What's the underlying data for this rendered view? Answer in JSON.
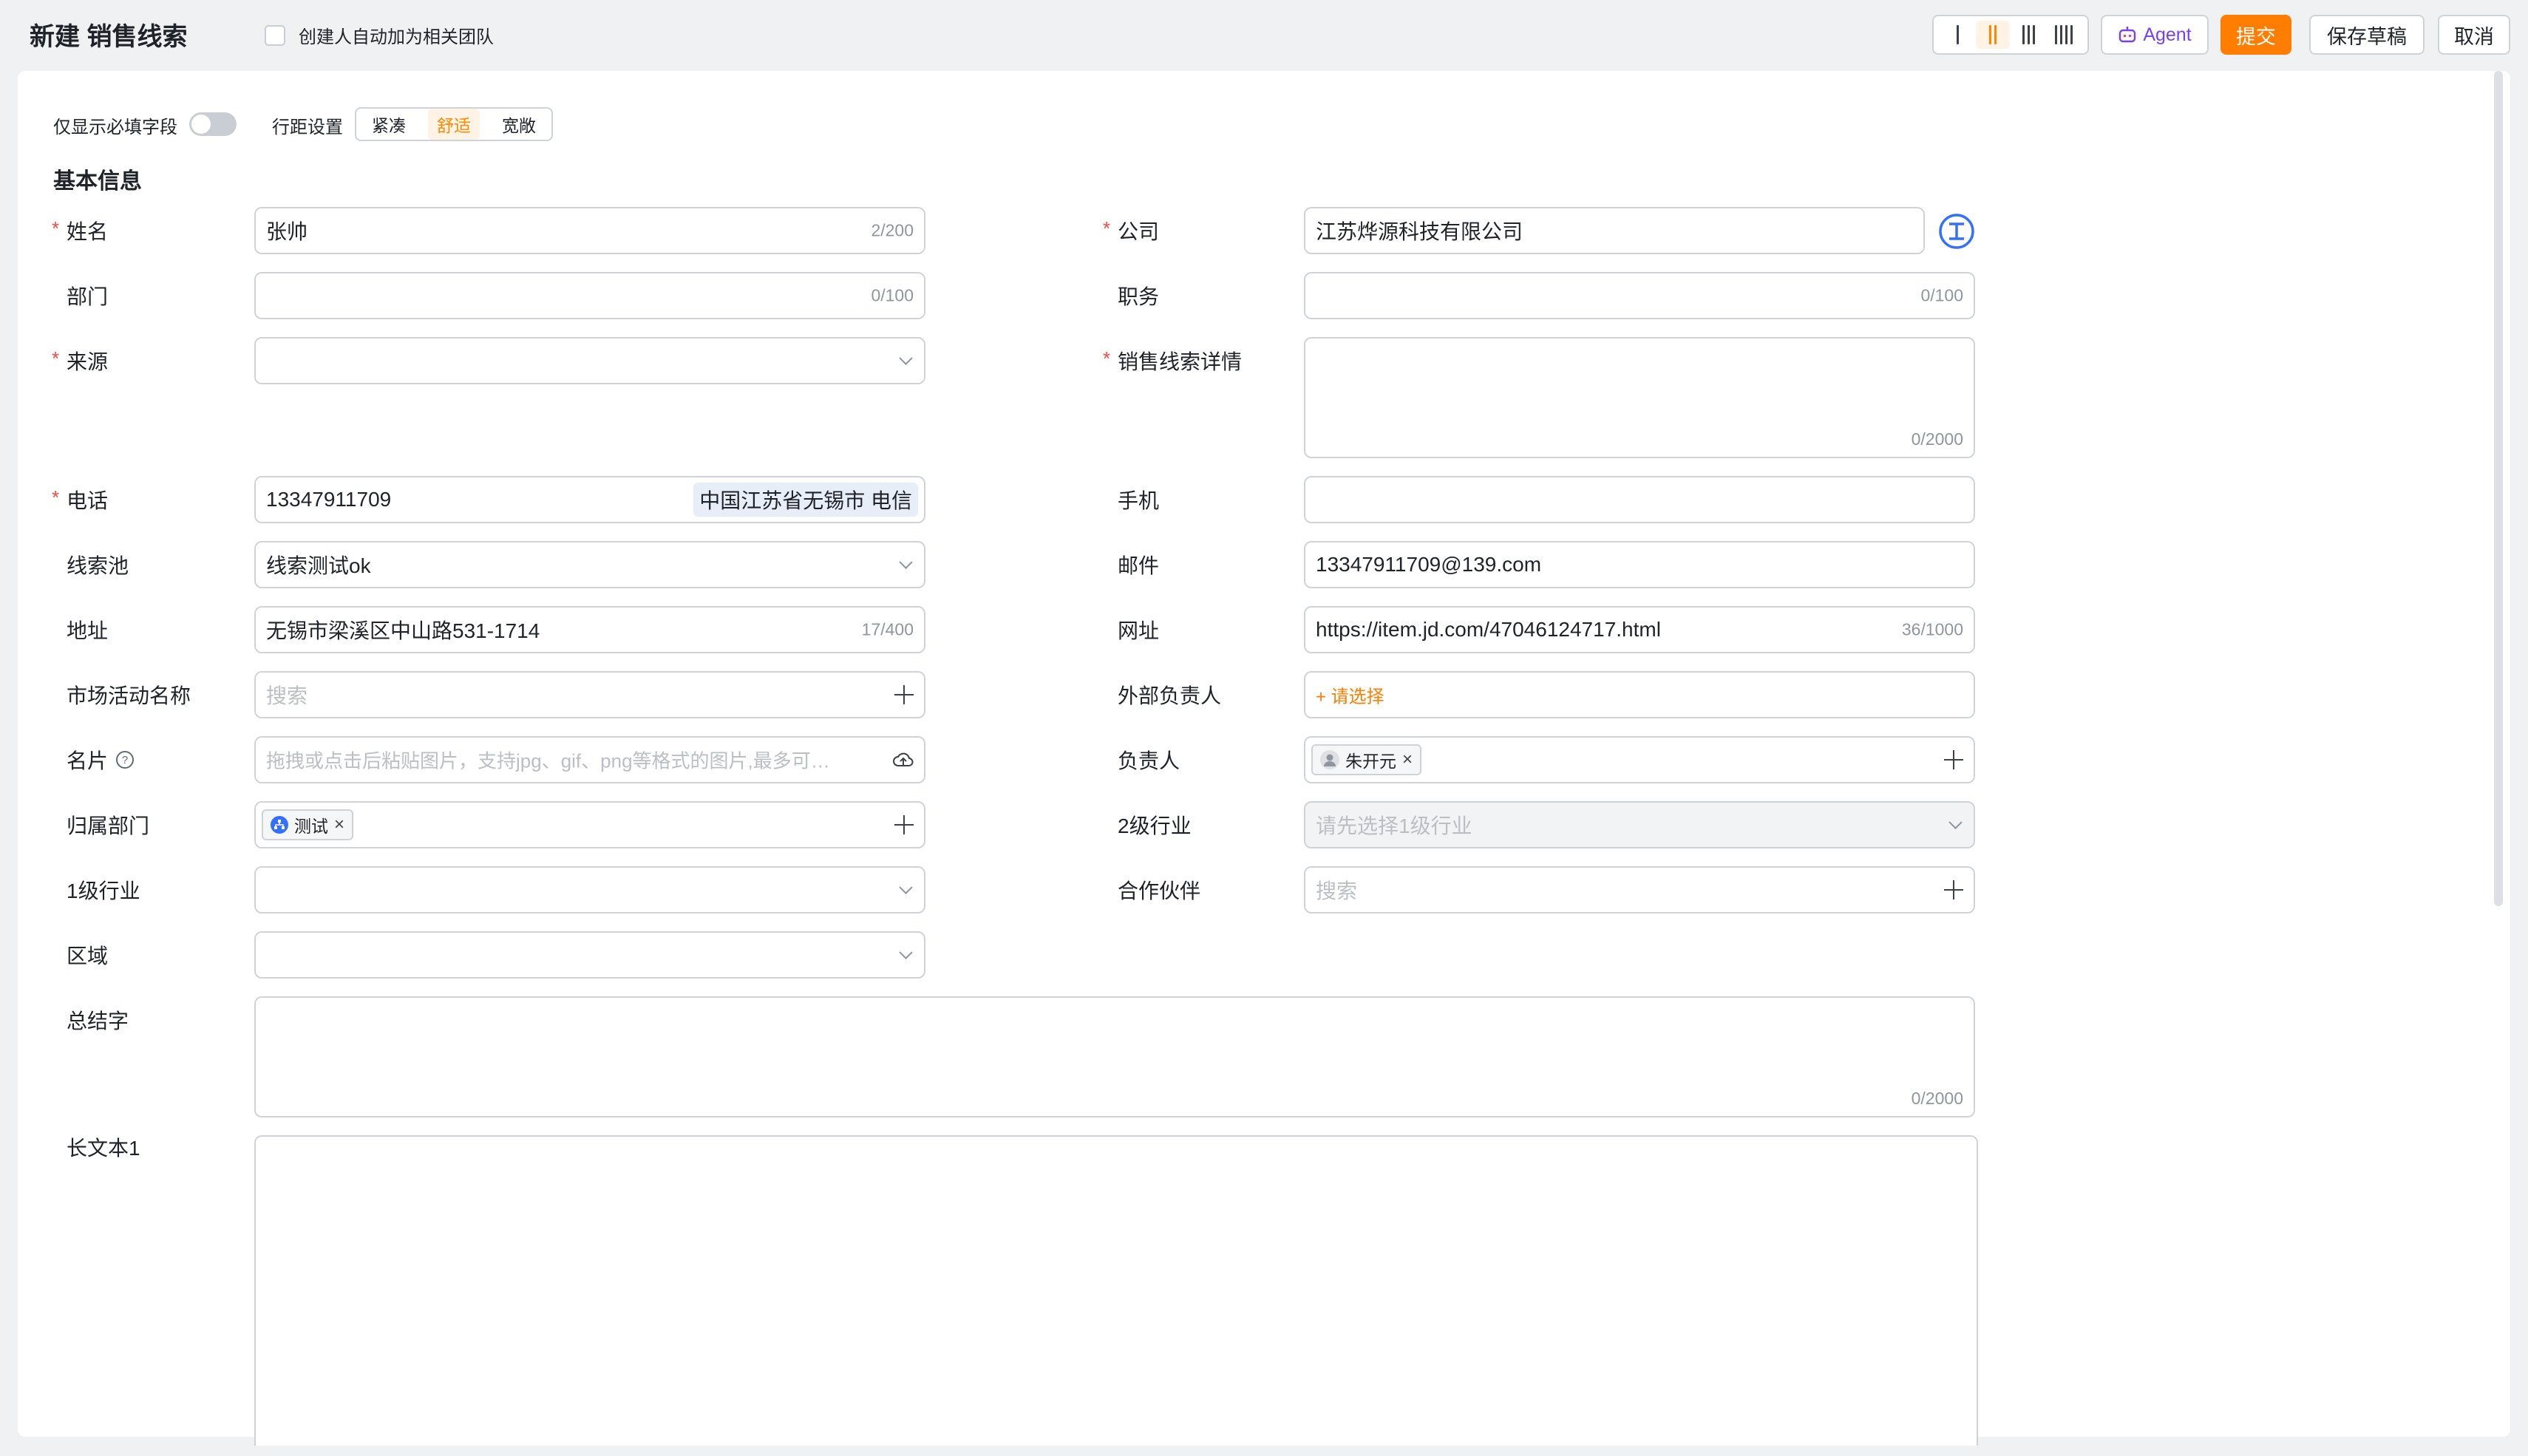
{
  "header": {
    "title": "新建 销售线索",
    "auto_team_label": "创建人自动加为相关团队",
    "agent_label": "Agent",
    "submit_label": "提交",
    "save_draft_label": "保存草稿",
    "cancel_label": "取消"
  },
  "options": {
    "required_only_label": "仅显示必填字段",
    "row_spacing_label": "行距设置",
    "density_options": [
      "紧凑",
      "舒适",
      "宽敞"
    ],
    "density_selected": "舒适"
  },
  "section": {
    "title": "基本信息"
  },
  "fields": {
    "name": {
      "label": "姓名",
      "value": "张帅",
      "count": "2/200"
    },
    "company": {
      "label": "公司",
      "value": "江苏烨源科技有限公司",
      "icon": "company-info-icon"
    },
    "department": {
      "label": "部门",
      "count": "0/100"
    },
    "position": {
      "label": "职务",
      "count": "0/100"
    },
    "source": {
      "label": "来源"
    },
    "lead_detail": {
      "label": "销售线索详情",
      "count": "0/2000"
    },
    "phone": {
      "label": "电话",
      "value": "13347911709",
      "location": "中国江苏省无锡市 电信"
    },
    "mobile": {
      "label": "手机"
    },
    "lead_pool": {
      "label": "线索池",
      "value": "线索测试ok"
    },
    "email": {
      "label": "邮件",
      "value": "13347911709@139.com"
    },
    "address": {
      "label": "地址",
      "value": "无锡市梁溪区中山路531-1714",
      "count": "17/400"
    },
    "website": {
      "label": "网址",
      "value": "https://item.jd.com/47046124717.html",
      "count": "36/1000"
    },
    "campaign": {
      "label": "市场活动名称",
      "placeholder": "搜索"
    },
    "external_owner": {
      "label": "外部负责人",
      "value": "+ 请选择"
    },
    "card": {
      "label": "名片",
      "placeholder": "拖拽或点击后粘贴图片，支持jpg、gif、png等格式的图片,最多可…"
    },
    "owner": {
      "label": "负责人",
      "tag": "朱开元"
    },
    "dept_owner": {
      "label": "归属部门",
      "tag": "测试"
    },
    "industry2": {
      "label": "2级行业",
      "placeholder": "请先选择1级行业"
    },
    "industry1": {
      "label": "1级行业"
    },
    "partner": {
      "label": "合作伙伴",
      "placeholder": "搜索"
    },
    "region": {
      "label": "区域"
    },
    "summary": {
      "label": "总结字",
      "count": "0/2000"
    },
    "longtext1": {
      "label": "长文本1"
    }
  },
  "colors": {
    "accent": "#ff7d00",
    "required": "#f54a45",
    "agent": "#7b3ff2"
  }
}
